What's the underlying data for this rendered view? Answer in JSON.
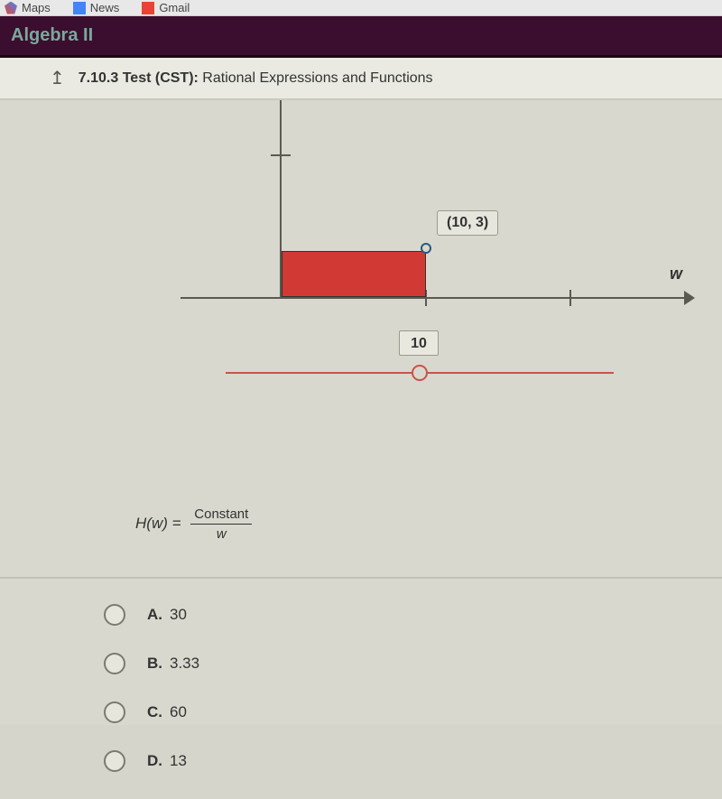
{
  "bookmarks": {
    "item1": "Maps",
    "item2": "News",
    "item3": "Gmail"
  },
  "course": {
    "title": "Algebra II"
  },
  "test": {
    "number": "7.10.3",
    "label_bold": "Test (CST):",
    "label_rest": "Rational Expressions and Functions"
  },
  "chart_data": {
    "type": "area",
    "title": "",
    "rectangle": {
      "x_start": 0,
      "x_end": 10,
      "y": 3
    },
    "open_point": {
      "x": 10,
      "y": 3,
      "label": "(10, 3)"
    },
    "xlabel": "w",
    "ylabel": "",
    "xlim": [
      0,
      30
    ],
    "ylim": [
      0,
      8
    ],
    "x_ticks": [
      10,
      20
    ],
    "y_ticks": [
      5
    ]
  },
  "slider": {
    "value": "10",
    "min": 0,
    "max": 20
  },
  "formula": {
    "lhs": "H(w) =",
    "numerator": "Constant",
    "denominator": "w"
  },
  "answers": [
    {
      "letter": "A.",
      "text": "30"
    },
    {
      "letter": "B.",
      "text": "3.33"
    },
    {
      "letter": "C.",
      "text": "60"
    },
    {
      "letter": "D.",
      "text": "13"
    }
  ]
}
